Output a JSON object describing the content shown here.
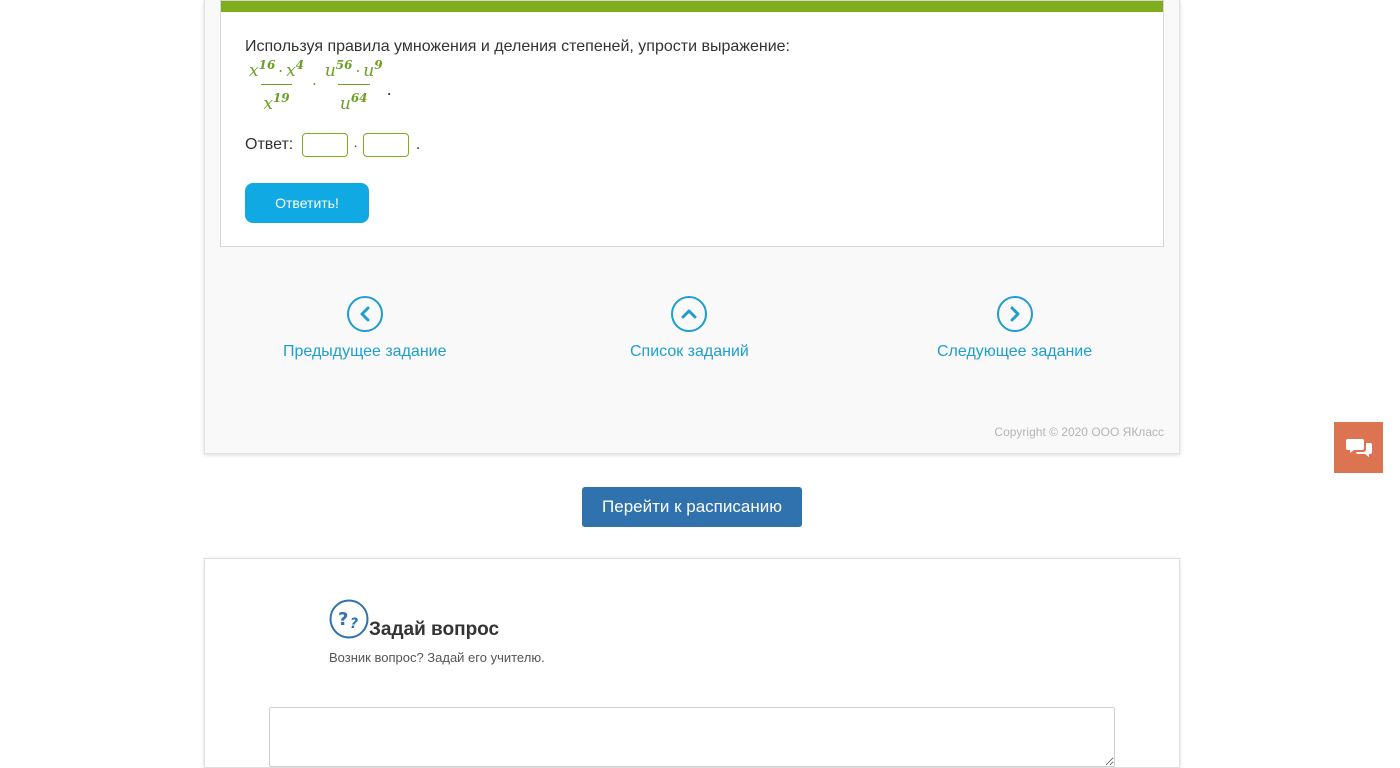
{
  "task": {
    "instruction": "Используя правила умножения и деления степеней, упрости выражение:",
    "expression": {
      "frac1": {
        "num_base1": "x",
        "num_exp1": "16",
        "num_base2": "x",
        "num_exp2": "4",
        "den_base": "x",
        "den_exp": "19"
      },
      "frac2": {
        "num_base1": "u",
        "num_exp1": "56",
        "num_base2": "u",
        "num_exp2": "9",
        "den_base": "u",
        "den_exp": "64"
      },
      "dot": "·",
      "end": "."
    },
    "answer_label": "Ответ:",
    "answer_sep": "·",
    "answer_end": ".",
    "submit_label": "Ответить!"
  },
  "nav": {
    "prev_label": "Предыдущее задание",
    "list_label": "Список заданий",
    "next_label": "Следующее задание"
  },
  "copyright": "Copyright © 2020 ООО ЯКласс",
  "schedule_label": "Перейти к расписанию",
  "question": {
    "title": "Задай вопрос",
    "subtitle": "Возник вопрос? Задай его учителю."
  },
  "colors": {
    "accent_green": "#7fae1c",
    "math_green": "#6a9f22",
    "button_blue": "#11a9e3",
    "link_blue": "#1f9ecf",
    "schedule_blue": "#2f72ad",
    "chat_orange": "#dc7451"
  },
  "icons": {
    "prev": "chevron-left-icon",
    "list": "chevron-up-icon",
    "next": "chevron-right-icon",
    "chat": "chat-bubbles-icon",
    "question": "question-marks-icon"
  }
}
